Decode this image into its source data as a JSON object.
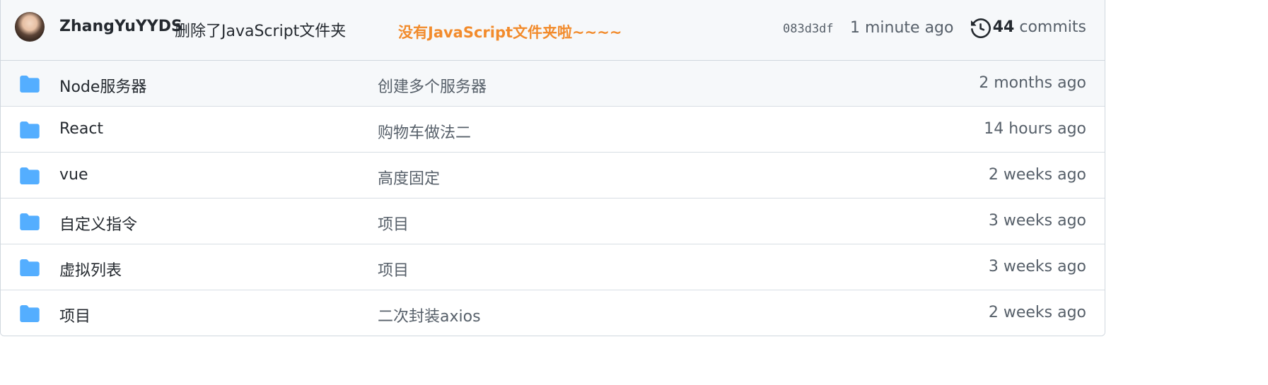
{
  "commit": {
    "author": "ZhangYuYYDS",
    "message": "删除了JavaScript文件夹",
    "annotation": "没有JavaScript文件夹啦~~~~",
    "sha": "083d3df",
    "time": "1 minute ago",
    "commit_count": "44",
    "commits_label": "commits",
    "history_icon": "history-icon",
    "avatar_icon": "avatar"
  },
  "colors": {
    "folder": "#54aeff",
    "annotation": "#f28b2c",
    "header_bg": "#f6f8fa",
    "border": "#d0d7de",
    "muted_text": "#57606a"
  },
  "files": [
    {
      "name": "Node服务器",
      "message": "创建多个服务器",
      "age": "2 months ago",
      "icon": "folder-icon"
    },
    {
      "name": "React",
      "message": "购物车做法二",
      "age": "14 hours ago",
      "icon": "folder-icon"
    },
    {
      "name": "vue",
      "message": "高度固定",
      "age": "2 weeks ago",
      "icon": "folder-icon"
    },
    {
      "name": "自定义指令",
      "message": "项目",
      "age": "3 weeks ago",
      "icon": "folder-icon"
    },
    {
      "name": "虚拟列表",
      "message": "项目",
      "age": "3 weeks ago",
      "icon": "folder-icon"
    },
    {
      "name": "项目",
      "message": "二次封装axios",
      "age": "2 weeks ago",
      "icon": "folder-icon"
    }
  ]
}
